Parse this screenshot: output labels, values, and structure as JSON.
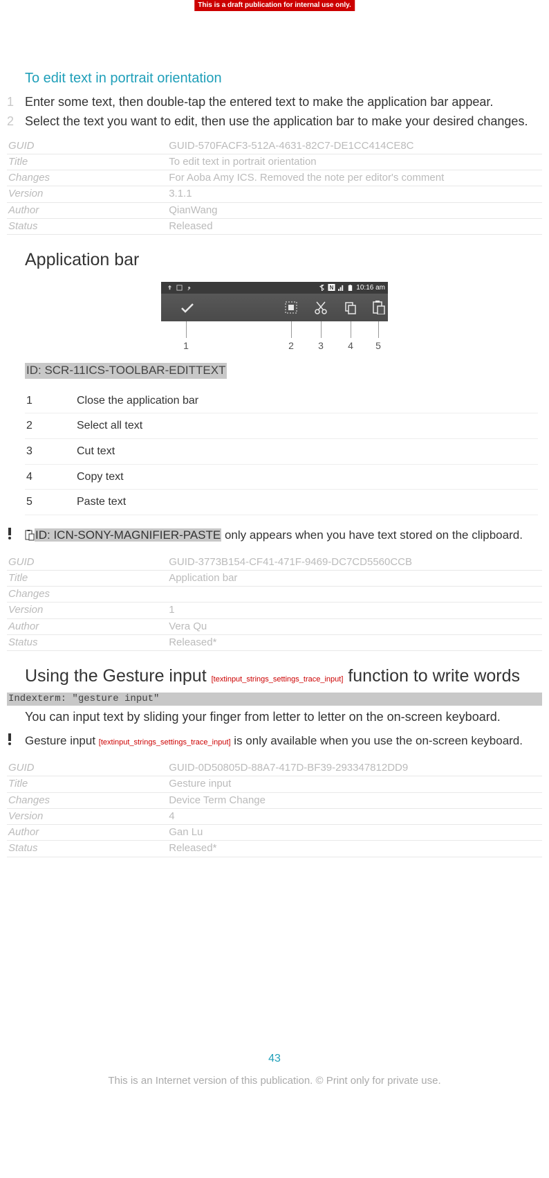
{
  "draft_banner": "This is a draft publication for internal use only.",
  "section1": {
    "title": "To edit text in portrait orientation",
    "steps": [
      "Enter some text, then double-tap the entered text to make the application bar appear.",
      "Select the text you want to edit, then use the application bar to make your desired changes."
    ],
    "meta": {
      "GUID": "GUID-570FACF3-512A-4631-82C7-DE1CC414CE8C",
      "Title": "To edit text in portrait orientation",
      "Changes": "For Aoba Amy ICS. Removed the note per editor's comment",
      "Version": "3.1.1",
      "Author": "QianWang",
      "Status": "Released"
    }
  },
  "section2": {
    "title": "Application bar",
    "statusbar_time": "10:16 am",
    "screenshot_id": "ID: SCR-11ICS-TOOLBAR-EDITTEXT",
    "legend": [
      {
        "n": "1",
        "t": "Close the application bar"
      },
      {
        "n": "2",
        "t": "Select all text"
      },
      {
        "n": "3",
        "t": "Cut text"
      },
      {
        "n": "4",
        "t": "Copy text"
      },
      {
        "n": "5",
        "t": "Paste text"
      }
    ],
    "note_icon_id": "ID: ICN-SONY-MAGNIFIER-PASTE",
    "note_text": " only appears when you have text stored on the clipboard.",
    "meta": {
      "GUID": "GUID-3773B154-CF41-471F-9469-DC7CD5560CCB",
      "Title": "Application bar",
      "Changes": "",
      "Version": "1",
      "Author": "Vera Qu",
      "Status": "Released*"
    }
  },
  "section3": {
    "title_a": "Using the Gesture input ",
    "title_ref": "[textinput_strings_settings_trace_input]",
    "title_b": " function to write words",
    "indexterm": "Indexterm: \"gesture input\"",
    "body": "You can input text by sliding your finger from letter to letter on the on-screen keyboard.",
    "note_a": "Gesture input ",
    "note_ref": "[textinput_strings_settings_trace_input]",
    "note_b": " is only available when you use the on-screen keyboard.",
    "meta": {
      "GUID": "GUID-0D50805D-88A7-417D-BF39-293347812DD9",
      "Title": "Gesture input",
      "Changes": "Device Term Change",
      "Version": "4",
      "Author": "Gan Lu",
      "Status": "Released*"
    }
  },
  "page_number": "43",
  "footer": "This is an Internet version of this publication. © Print only for private use."
}
